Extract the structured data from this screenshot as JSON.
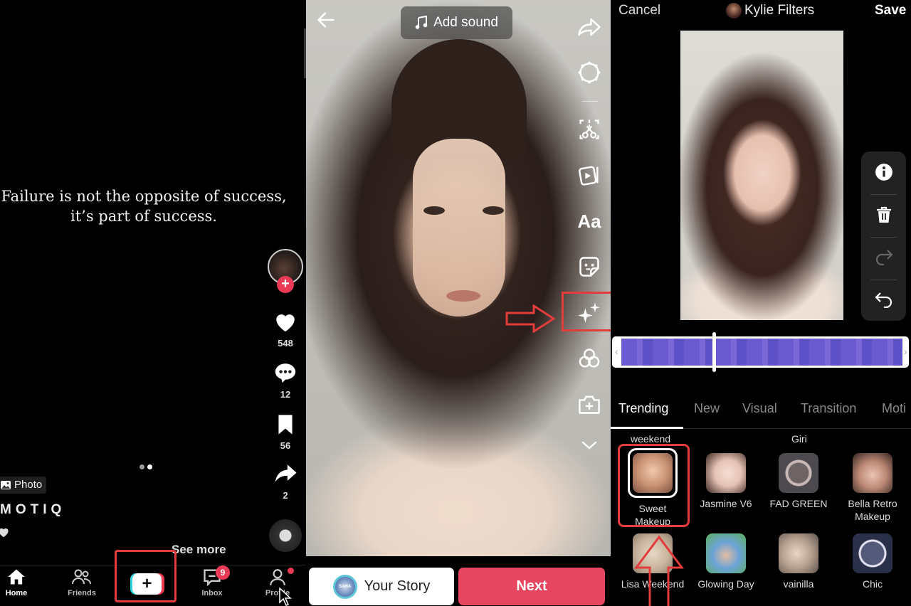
{
  "panel_feed": {
    "quote": "Failure is not the opposite of success, it’s part of success.",
    "actions": {
      "likes": "548",
      "comments": "12",
      "saves": "56",
      "shares": "2"
    },
    "photo_badge": "Photo",
    "author": "MOTIQ",
    "see_more": "See more",
    "carousel": {
      "total": 2,
      "active": 2
    },
    "nav": {
      "home": "Home",
      "friends": "Friends",
      "inbox": "Inbox",
      "inbox_badge": "9",
      "profile": "Profile"
    },
    "colors": {
      "accent": "#ea3a55",
      "annotation": "#e23c3c"
    }
  },
  "panel_editor": {
    "add_sound": "Add sound",
    "tools": [
      "share-forward",
      "enhance",
      "cut",
      "templates",
      "text",
      "stickers",
      "effects",
      "filters",
      "add-clip",
      "more"
    ],
    "text_tool_label": "Aa",
    "story_button": "Your Story",
    "story_avatar_text": "SAHA",
    "next_button": "Next",
    "colors": {
      "next": "#e6465f"
    }
  },
  "panel_effects": {
    "cancel": "Cancel",
    "title": "Kylie Filters",
    "save": "Save",
    "side_tools": [
      "info",
      "delete",
      "redo",
      "undo"
    ],
    "tabs": [
      {
        "label": "Trending",
        "active": true
      },
      {
        "label": "New",
        "active": false
      },
      {
        "label": "Visual",
        "active": false
      },
      {
        "label": "Transition",
        "active": false
      },
      {
        "label": "Moti",
        "active": false
      }
    ],
    "previous_row_labels": [
      "weekend",
      "Giri"
    ],
    "effects": [
      {
        "name": "Sweet\nMakeup",
        "line1": "Sweet",
        "line2": "Makeup",
        "selected": true
      },
      {
        "name": "Jasmine V6",
        "line1": "Jasmine V6",
        "line2": "",
        "selected": false
      },
      {
        "name": "FAD GREEN",
        "line1": "FAD GREEN",
        "line2": "",
        "selected": false
      },
      {
        "name": "Bella Retro Makeup",
        "line1": "Bella Retro",
        "line2": "Makeup",
        "selected": false
      },
      {
        "name": "Lisa Weekend",
        "line1": "Lisa Weekend",
        "line2": "",
        "selected": false
      },
      {
        "name": "Glowing Day",
        "line1": "Glowing Day",
        "line2": "",
        "selected": false
      },
      {
        "name": "vainilla",
        "line1": "vainilla",
        "line2": "",
        "selected": false
      },
      {
        "name": "Chic",
        "line1": "Chic",
        "line2": "",
        "selected": false
      }
    ],
    "timeline": {
      "playhead_fraction": 0.33,
      "clip_color": "#6a5bd1"
    }
  }
}
